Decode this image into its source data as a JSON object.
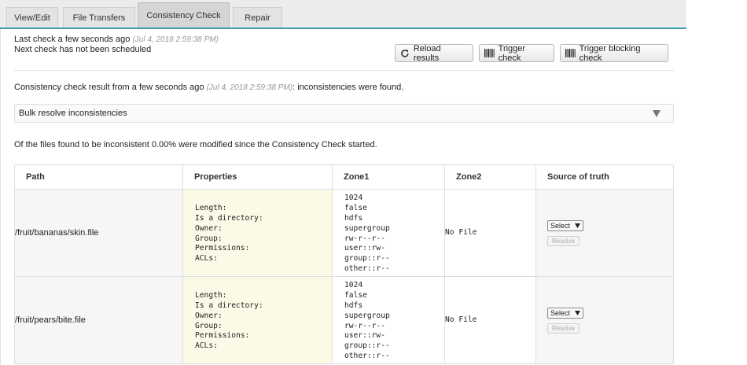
{
  "tabs": [
    {
      "label": "View/Edit",
      "active": false
    },
    {
      "label": "File Transfers",
      "active": false
    },
    {
      "label": "Consistency Check",
      "active": true
    },
    {
      "label": "Repair",
      "active": false
    }
  ],
  "status": {
    "last_check_label": "Last check a few seconds ago",
    "last_check_time": "(Jul 4, 2018 2:59:38 PM)",
    "next_check": "Next check has not been scheduled"
  },
  "actions": {
    "reload": "Reload results",
    "trigger": "Trigger check",
    "trigger_blocking": "Trigger blocking check"
  },
  "result": {
    "prefix": "Consistency check result from a few seconds ago",
    "time": "(Jul 4, 2018 2:59:38 PM)",
    "suffix": ": inconsistencies were found."
  },
  "bulk": {
    "label": "Bulk resolve inconsistencies"
  },
  "summary": "Of the files found to be inconsistent 0.00% were modified since the Consistency Check started.",
  "table": {
    "headers": {
      "path": "Path",
      "properties": "Properties",
      "zone1": "Zone1",
      "zone2": "Zone2",
      "source": "Source of truth"
    },
    "property_labels": "Length:\nIs a directory:\nOwner:\nGroup:\nPermissions:\nACLs:",
    "select_label": "Select",
    "resolve_label": "Resolve",
    "rows": [
      {
        "path": "/fruit/bananas/skin.file",
        "zone1": "1024\nfalse\nhdfs\nsupergroup\nrw-r--r--\nuser::rw-\ngroup::r--\nother::r--",
        "zone2": "No File"
      },
      {
        "path": "/fruit/pears/bite.file",
        "zone1": "1024\nfalse\nhdfs\nsupergroup\nrw-r--r--\nuser::rw-\ngroup::r--\nother::r--",
        "zone2": "No File"
      }
    ]
  },
  "colors": {
    "accent": "#3a9ab0",
    "properties_bg": "#fafae6"
  },
  "icons": {
    "reload": "refresh-icon",
    "trigger": "barcode-icon"
  }
}
